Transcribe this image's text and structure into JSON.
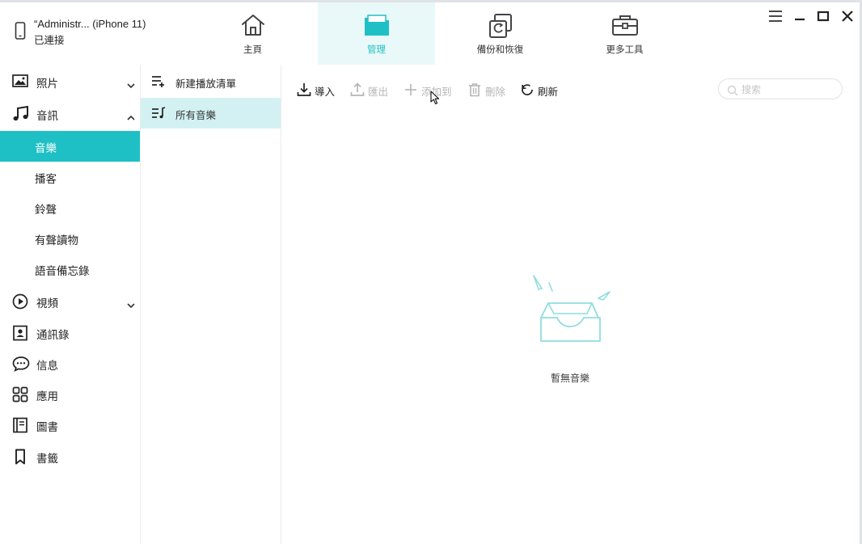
{
  "device": {
    "name": "“Administr... (iPhone 11)",
    "status": "已連接"
  },
  "nav": {
    "tabs": [
      {
        "label": "主頁",
        "icon": "home-icon"
      },
      {
        "label": "管理",
        "icon": "folder-icon",
        "active": true
      },
      {
        "label": "備份和恢復",
        "icon": "backup-restore-icon"
      },
      {
        "label": "更多工具",
        "icon": "toolbox-icon"
      }
    ]
  },
  "sidebar": {
    "items": [
      {
        "label": "照片",
        "icon": "photo-icon",
        "expanded": false
      },
      {
        "label": "音訊",
        "icon": "music-note-icon",
        "expanded": true
      },
      {
        "label": "視頻",
        "icon": "play-circle-icon",
        "expanded": false
      },
      {
        "label": "通訊錄",
        "icon": "contacts-icon"
      },
      {
        "label": "信息",
        "icon": "message-icon"
      },
      {
        "label": "應用",
        "icon": "apps-grid-icon"
      },
      {
        "label": "圖書",
        "icon": "book-icon"
      },
      {
        "label": "書籤",
        "icon": "bookmark-icon"
      }
    ],
    "audio_sub": [
      {
        "label": "音樂",
        "active": true
      },
      {
        "label": "播客"
      },
      {
        "label": "鈴聲"
      },
      {
        "label": "有聲讀物"
      },
      {
        "label": "語音備忘錄"
      }
    ]
  },
  "playlists": {
    "new_label": "新建播放清單",
    "all_label": "所有音樂"
  },
  "toolbar": {
    "import_label": "導入",
    "export_label": "匯出",
    "add_to_label": "添加到",
    "delete_label": "刪除",
    "refresh_label": "刷新"
  },
  "search": {
    "placeholder": "搜索",
    "value": ""
  },
  "empty": {
    "message": "暫無音樂"
  },
  "colors": {
    "accent": "#1fc0c5",
    "accent_light": "#d3f1f2",
    "tab_active_bg": "#e9f8f8",
    "disabled": "#b5b5b5"
  }
}
